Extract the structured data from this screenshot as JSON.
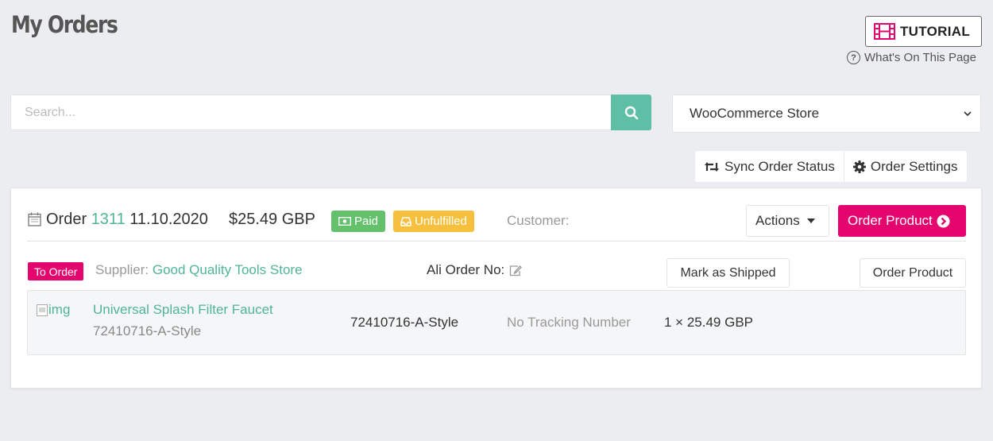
{
  "page": {
    "title": "My Orders"
  },
  "header": {
    "tutorial_label": "TUTORIAL",
    "whats_on_label": "What's On This Page"
  },
  "search": {
    "placeholder": "Search...",
    "value": ""
  },
  "store_select": {
    "selected": "WooCommerce Store"
  },
  "toolbar": {
    "sync_label": "Sync Order Status",
    "settings_label": "Order Settings"
  },
  "order": {
    "label": "Order",
    "number": "1311",
    "date": "11.10.2020",
    "amount": "$25.49 GBP",
    "paid_badge": "Paid",
    "fulfillment_badge": "Unfulfilled",
    "customer_label": "Customer:",
    "actions_label": "Actions",
    "order_product_label": "Order Product",
    "supplier_group": {
      "status_badge": "To Order",
      "supplier_label": "Supplier:",
      "supplier_name": "Good Quality Tools Store",
      "ali_order_label": "Ali Order No:",
      "mark_shipped_label": "Mark as Shipped",
      "order_product_label": "Order Product"
    },
    "items": [
      {
        "img_alt": "img",
        "title": "Universal Splash Filter Faucet",
        "variant": "72410716-A-Style",
        "sku": "72410716-A-Style",
        "tracking": "No Tracking Number",
        "quantity_price": "1 × 25.49 GBP"
      }
    ]
  },
  "colors": {
    "accent_teal": "#5fbfa6",
    "link_green": "#4fb596",
    "primary_pink": "#e4066e",
    "paid_green": "#62c16a",
    "unfulfilled_yellow": "#f7bf3e",
    "background": "#ecedf1"
  },
  "icons": {
    "tutorial": "film-icon",
    "whats_on": "question-circle-icon",
    "search": "search-icon",
    "select": "chevron-down-icon",
    "sync": "retweet-icon",
    "settings": "gear-icon",
    "order": "calendar-icon",
    "paid": "money-icon",
    "unfulfilled": "inbox-icon",
    "actions": "caret-down-icon",
    "order_product": "chevron-circle-right-icon",
    "ali_edit": "edit-icon"
  }
}
